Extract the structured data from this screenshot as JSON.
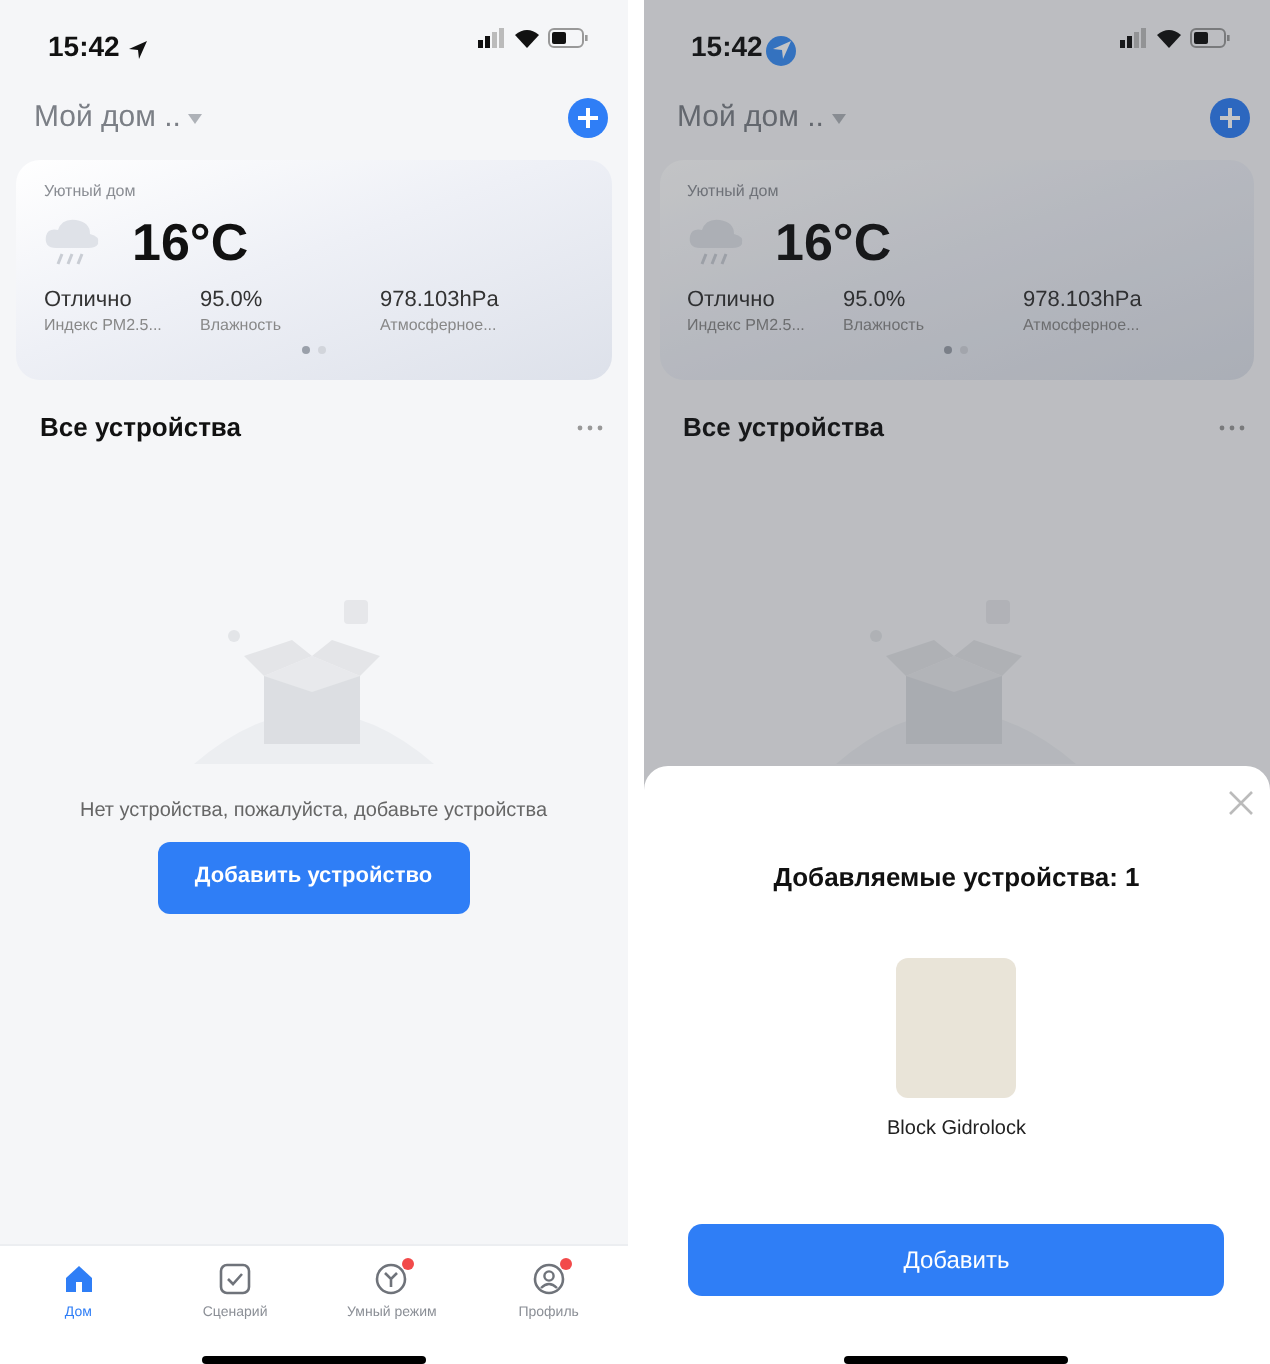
{
  "phones": [
    {
      "status_bar": {
        "time": "15:42",
        "location_highlighted": false
      },
      "header": {
        "home_name": "Мой дом .."
      },
      "weather_card": {
        "place": "Уютный дом",
        "temperature": "16°C",
        "metrics": [
          {
            "value": "Отлично",
            "label": "Индекс PM2.5..."
          },
          {
            "value": "95.0%",
            "label": "Влажность"
          },
          {
            "value": "978.103hPa",
            "label": "Атмосферное..."
          }
        ],
        "pages": [
          {
            "selected": true
          },
          {
            "selected": false
          }
        ]
      },
      "section_title": "Все устройства",
      "empty_state": {
        "message": "Нет устройства, пожалуйста, добавьте устройства",
        "button": "Добавить устройство"
      },
      "tab_bar": [
        {
          "label": "Дом",
          "kind": "home",
          "selected": true,
          "badge": false
        },
        {
          "label": "Сценарий",
          "kind": "scene",
          "selected": false,
          "badge": false
        },
        {
          "label": "Умный режим",
          "kind": "smart",
          "selected": false,
          "badge": true
        },
        {
          "label": "Профиль",
          "kind": "profile",
          "selected": false,
          "badge": true
        }
      ]
    },
    {
      "status_bar": {
        "time": "15:42",
        "location_highlighted": true
      },
      "header": {
        "home_name": "Мой дом .."
      },
      "weather_card": {
        "place": "Уютный дом",
        "temperature": "16°C",
        "metrics": [
          {
            "value": "Отлично",
            "label": "Индекс PM2.5..."
          },
          {
            "value": "95.0%",
            "label": "Влажность"
          },
          {
            "value": "978.103hPa",
            "label": "Атмосферное..."
          }
        ],
        "pages": [
          {
            "selected": true
          },
          {
            "selected": false
          }
        ]
      },
      "section_title": "Все устройства",
      "sheet": {
        "title": "Добавляемые устройства: 1",
        "devices": [
          {
            "name": "Block Gidrolock"
          }
        ],
        "button": "Добавить"
      }
    }
  ]
}
